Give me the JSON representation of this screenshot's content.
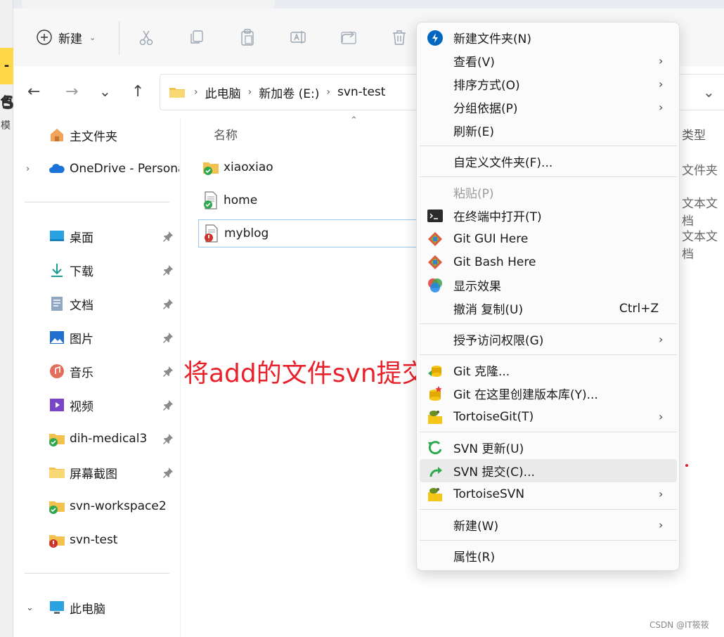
{
  "edge": {
    "badge": "-色",
    "s": "S",
    "mo": "模"
  },
  "toolbar": {
    "new_label": "新建",
    "new_caret": "⌄"
  },
  "address": {
    "crumbs": [
      "此电脑",
      "新加卷 (E:)",
      "svn-test"
    ],
    "sep": "›",
    "dropdown": "⌄"
  },
  "nav": {
    "back": "←",
    "forward": "→",
    "recent": "⌄",
    "up": "↑"
  },
  "sidebar": {
    "top": [
      {
        "label": "主文件夹"
      },
      {
        "label": "OneDrive - Personal",
        "expander": "›"
      }
    ],
    "quick": [
      {
        "label": "桌面"
      },
      {
        "label": "下载"
      },
      {
        "label": "文档"
      },
      {
        "label": "图片"
      },
      {
        "label": "音乐"
      },
      {
        "label": "视频"
      },
      {
        "label": "dih-medical3"
      },
      {
        "label": "屏幕截图"
      },
      {
        "label": "svn-workspace2"
      },
      {
        "label": "svn-test"
      }
    ],
    "bottom": [
      {
        "label": "此电脑",
        "expander": "⌄"
      }
    ]
  },
  "files": {
    "columns": {
      "name": "名称",
      "sort": "⌃",
      "type": "类型"
    },
    "rows": [
      {
        "name": "xiaoxiao",
        "type": "文件夹"
      },
      {
        "name": "home",
        "type": "文本文档"
      },
      {
        "name": "myblog",
        "type": "文本文档"
      }
    ]
  },
  "annotation": "将add的文件svn提交",
  "watermark": "CSDN @IT筱筱",
  "context_menu": {
    "arrow": "›",
    "items": [
      {
        "label": "新建文件夹(N)"
      },
      {
        "label": "查看(V)"
      },
      {
        "label": "排序方式(O)"
      },
      {
        "label": "分组依据(P)"
      },
      {
        "label": "刷新(E)"
      },
      {
        "label": "自定义文件夹(F)..."
      },
      {
        "label": "粘贴(P)"
      },
      {
        "label": "在终端中打开(T)"
      },
      {
        "label": "Git GUI Here"
      },
      {
        "label": "Git Bash Here"
      },
      {
        "label": "显示效果"
      },
      {
        "label": "撤消 复制(U)",
        "shortcut": "Ctrl+Z"
      },
      {
        "label": "授予访问权限(G)"
      },
      {
        "label": "Git 克隆..."
      },
      {
        "label": "Git 在这里创建版本库(Y)..."
      },
      {
        "label": "TortoiseGit(T)"
      },
      {
        "label": "SVN 更新(U)"
      },
      {
        "label": "SVN 提交(C)..."
      },
      {
        "label": "TortoiseSVN"
      },
      {
        "label": "新建(W)"
      },
      {
        "label": "属性(R)"
      }
    ]
  },
  "colors": {
    "accent": "#0067c0",
    "annotation": "#e8212a",
    "folder": "#f2c14e",
    "svn_ok": "#2fa84f",
    "svn_modified": "#d0302b"
  }
}
